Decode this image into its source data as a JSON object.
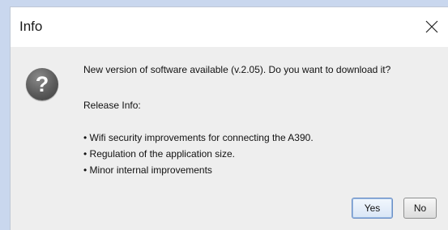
{
  "dialog": {
    "title": "Info",
    "message": "New version of software available (v.2.05). Do you want to download it?",
    "release_info_label": "Release Info:",
    "bullets": [
      "• Wifi security improvements for connecting the A390.",
      "• Regulation of the application size.",
      "• Minor internal improvements"
    ],
    "buttons": {
      "yes": "Yes",
      "no": "No"
    },
    "icon_glyph": "?"
  }
}
